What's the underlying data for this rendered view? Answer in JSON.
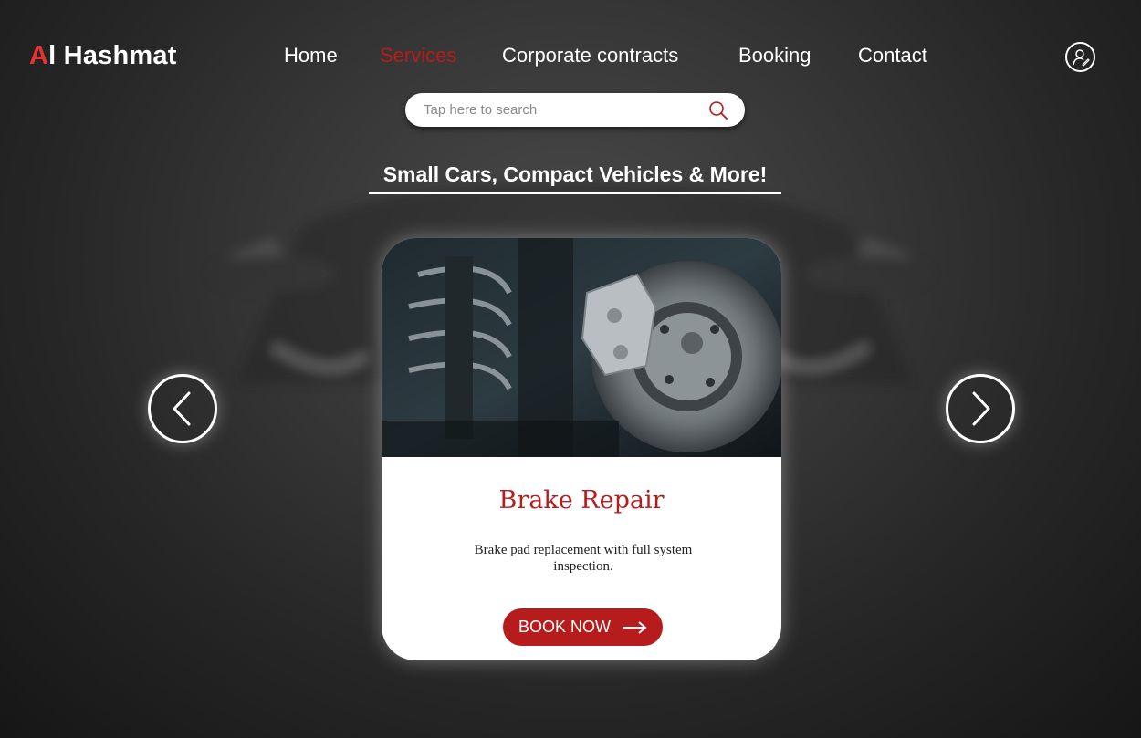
{
  "brand": {
    "accent_part": "A",
    "rest": "l Hashmat",
    "accent_color": "#e43333"
  },
  "nav": {
    "items": [
      {
        "label": "Home",
        "active": false
      },
      {
        "label": "Services",
        "active": true
      },
      {
        "label": "Corporate contracts",
        "active": false
      },
      {
        "label": "Booking",
        "active": false
      },
      {
        "label": "Contact",
        "active": false
      }
    ],
    "active_color": "#b71c1c",
    "user_icon": "user-icon"
  },
  "search": {
    "placeholder": "Tap here to search",
    "value": "",
    "icon": "search-icon",
    "icon_color": "#b71c1c"
  },
  "section": {
    "heading": "Small Cars, Compact Vehicles & More!"
  },
  "carousel": {
    "prev_icon": "chevron-left-icon",
    "next_icon": "chevron-right-icon",
    "card": {
      "image": "brake-disc-photo",
      "title": "Brake Repair",
      "description": "Brake pad replacement with full system inspection.",
      "button_label": "BOOK NOW",
      "button_icon": "arrow-right-icon",
      "title_color": "#b71c1c",
      "button_color": "#b71c1c"
    }
  }
}
